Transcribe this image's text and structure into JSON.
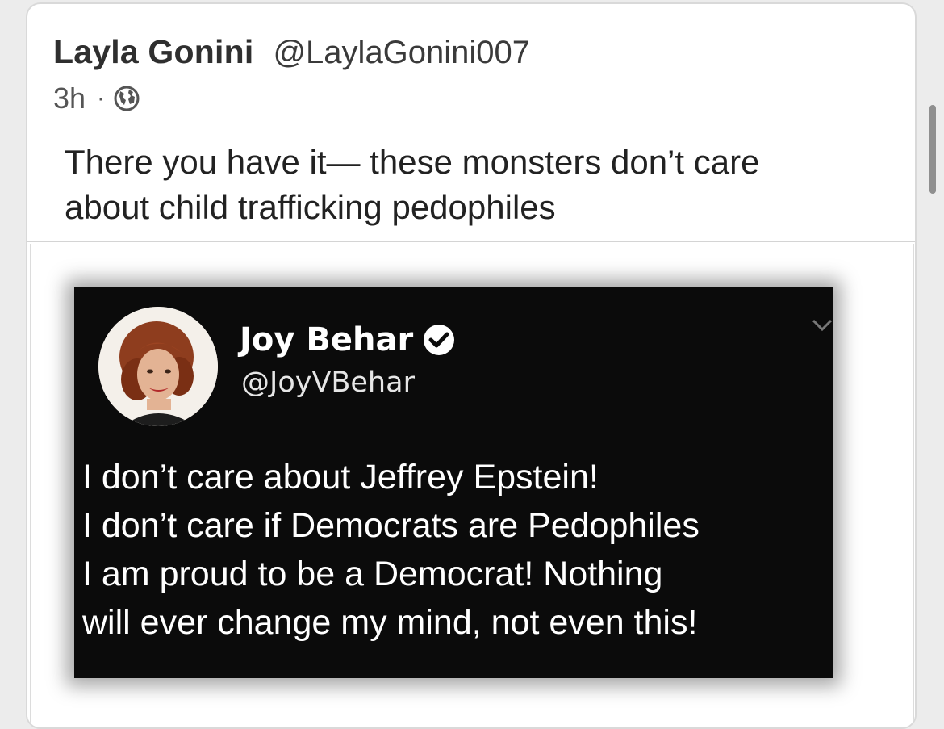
{
  "post": {
    "author_name": "Layla Gonini",
    "author_handle": "@LaylaGonini007",
    "timestamp": "3h",
    "separator": "·",
    "visibility_icon": "globe-icon",
    "text_lines": [
      "There you have it— these monsters don’t care",
      "about child trafficking pedophiles"
    ]
  },
  "attachment": {
    "tweet": {
      "name": "Joy Behar",
      "handle": "@JoyVBehar",
      "verified_icon": "verified-badge-icon",
      "menu_icon": "chevron-down-icon",
      "text_lines": [
        "I don’t care about Jeffrey Epstein!",
        "I don’t care if Democrats are Pedophiles",
        "I am proud to be a Democrat! Nothing",
        "will ever change my mind, not even this!"
      ]
    }
  },
  "colors": {
    "card_background": "#ffffff",
    "tweet_background": "#0b0b0b",
    "text_primary": "#222222"
  }
}
